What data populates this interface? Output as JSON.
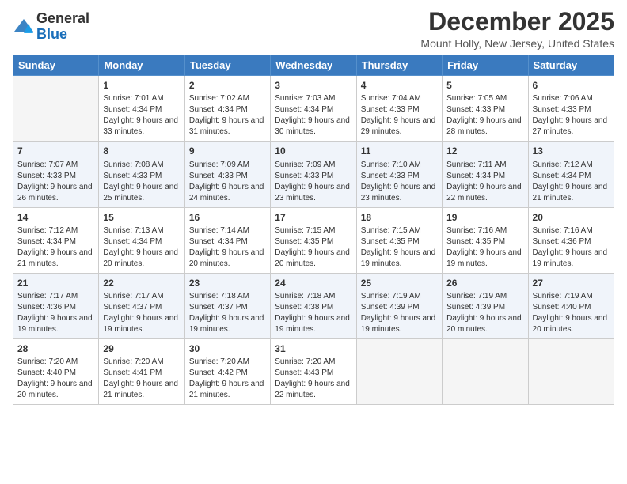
{
  "logo": {
    "text_general": "General",
    "text_blue": "Blue"
  },
  "header": {
    "month": "December 2025",
    "location": "Mount Holly, New Jersey, United States"
  },
  "days_of_week": [
    "Sunday",
    "Monday",
    "Tuesday",
    "Wednesday",
    "Thursday",
    "Friday",
    "Saturday"
  ],
  "weeks": [
    [
      {
        "day": "",
        "sunrise": "",
        "sunset": "",
        "daylight": "",
        "empty": true
      },
      {
        "day": "1",
        "sunrise": "Sunrise: 7:01 AM",
        "sunset": "Sunset: 4:34 PM",
        "daylight": "Daylight: 9 hours and 33 minutes."
      },
      {
        "day": "2",
        "sunrise": "Sunrise: 7:02 AM",
        "sunset": "Sunset: 4:34 PM",
        "daylight": "Daylight: 9 hours and 31 minutes."
      },
      {
        "day": "3",
        "sunrise": "Sunrise: 7:03 AM",
        "sunset": "Sunset: 4:34 PM",
        "daylight": "Daylight: 9 hours and 30 minutes."
      },
      {
        "day": "4",
        "sunrise": "Sunrise: 7:04 AM",
        "sunset": "Sunset: 4:33 PM",
        "daylight": "Daylight: 9 hours and 29 minutes."
      },
      {
        "day": "5",
        "sunrise": "Sunrise: 7:05 AM",
        "sunset": "Sunset: 4:33 PM",
        "daylight": "Daylight: 9 hours and 28 minutes."
      },
      {
        "day": "6",
        "sunrise": "Sunrise: 7:06 AM",
        "sunset": "Sunset: 4:33 PM",
        "daylight": "Daylight: 9 hours and 27 minutes."
      }
    ],
    [
      {
        "day": "7",
        "sunrise": "Sunrise: 7:07 AM",
        "sunset": "Sunset: 4:33 PM",
        "daylight": "Daylight: 9 hours and 26 minutes."
      },
      {
        "day": "8",
        "sunrise": "Sunrise: 7:08 AM",
        "sunset": "Sunset: 4:33 PM",
        "daylight": "Daylight: 9 hours and 25 minutes."
      },
      {
        "day": "9",
        "sunrise": "Sunrise: 7:09 AM",
        "sunset": "Sunset: 4:33 PM",
        "daylight": "Daylight: 9 hours and 24 minutes."
      },
      {
        "day": "10",
        "sunrise": "Sunrise: 7:09 AM",
        "sunset": "Sunset: 4:33 PM",
        "daylight": "Daylight: 9 hours and 23 minutes."
      },
      {
        "day": "11",
        "sunrise": "Sunrise: 7:10 AM",
        "sunset": "Sunset: 4:33 PM",
        "daylight": "Daylight: 9 hours and 23 minutes."
      },
      {
        "day": "12",
        "sunrise": "Sunrise: 7:11 AM",
        "sunset": "Sunset: 4:34 PM",
        "daylight": "Daylight: 9 hours and 22 minutes."
      },
      {
        "day": "13",
        "sunrise": "Sunrise: 7:12 AM",
        "sunset": "Sunset: 4:34 PM",
        "daylight": "Daylight: 9 hours and 21 minutes."
      }
    ],
    [
      {
        "day": "14",
        "sunrise": "Sunrise: 7:12 AM",
        "sunset": "Sunset: 4:34 PM",
        "daylight": "Daylight: 9 hours and 21 minutes."
      },
      {
        "day": "15",
        "sunrise": "Sunrise: 7:13 AM",
        "sunset": "Sunset: 4:34 PM",
        "daylight": "Daylight: 9 hours and 20 minutes."
      },
      {
        "day": "16",
        "sunrise": "Sunrise: 7:14 AM",
        "sunset": "Sunset: 4:34 PM",
        "daylight": "Daylight: 9 hours and 20 minutes."
      },
      {
        "day": "17",
        "sunrise": "Sunrise: 7:15 AM",
        "sunset": "Sunset: 4:35 PM",
        "daylight": "Daylight: 9 hours and 20 minutes."
      },
      {
        "day": "18",
        "sunrise": "Sunrise: 7:15 AM",
        "sunset": "Sunset: 4:35 PM",
        "daylight": "Daylight: 9 hours and 19 minutes."
      },
      {
        "day": "19",
        "sunrise": "Sunrise: 7:16 AM",
        "sunset": "Sunset: 4:35 PM",
        "daylight": "Daylight: 9 hours and 19 minutes."
      },
      {
        "day": "20",
        "sunrise": "Sunrise: 7:16 AM",
        "sunset": "Sunset: 4:36 PM",
        "daylight": "Daylight: 9 hours and 19 minutes."
      }
    ],
    [
      {
        "day": "21",
        "sunrise": "Sunrise: 7:17 AM",
        "sunset": "Sunset: 4:36 PM",
        "daylight": "Daylight: 9 hours and 19 minutes."
      },
      {
        "day": "22",
        "sunrise": "Sunrise: 7:17 AM",
        "sunset": "Sunset: 4:37 PM",
        "daylight": "Daylight: 9 hours and 19 minutes."
      },
      {
        "day": "23",
        "sunrise": "Sunrise: 7:18 AM",
        "sunset": "Sunset: 4:37 PM",
        "daylight": "Daylight: 9 hours and 19 minutes."
      },
      {
        "day": "24",
        "sunrise": "Sunrise: 7:18 AM",
        "sunset": "Sunset: 4:38 PM",
        "daylight": "Daylight: 9 hours and 19 minutes."
      },
      {
        "day": "25",
        "sunrise": "Sunrise: 7:19 AM",
        "sunset": "Sunset: 4:39 PM",
        "daylight": "Daylight: 9 hours and 19 minutes."
      },
      {
        "day": "26",
        "sunrise": "Sunrise: 7:19 AM",
        "sunset": "Sunset: 4:39 PM",
        "daylight": "Daylight: 9 hours and 20 minutes."
      },
      {
        "day": "27",
        "sunrise": "Sunrise: 7:19 AM",
        "sunset": "Sunset: 4:40 PM",
        "daylight": "Daylight: 9 hours and 20 minutes."
      }
    ],
    [
      {
        "day": "28",
        "sunrise": "Sunrise: 7:20 AM",
        "sunset": "Sunset: 4:40 PM",
        "daylight": "Daylight: 9 hours and 20 minutes."
      },
      {
        "day": "29",
        "sunrise": "Sunrise: 7:20 AM",
        "sunset": "Sunset: 4:41 PM",
        "daylight": "Daylight: 9 hours and 21 minutes."
      },
      {
        "day": "30",
        "sunrise": "Sunrise: 7:20 AM",
        "sunset": "Sunset: 4:42 PM",
        "daylight": "Daylight: 9 hours and 21 minutes."
      },
      {
        "day": "31",
        "sunrise": "Sunrise: 7:20 AM",
        "sunset": "Sunset: 4:43 PM",
        "daylight": "Daylight: 9 hours and 22 minutes."
      },
      {
        "day": "",
        "sunrise": "",
        "sunset": "",
        "daylight": "",
        "empty": true
      },
      {
        "day": "",
        "sunrise": "",
        "sunset": "",
        "daylight": "",
        "empty": true
      },
      {
        "day": "",
        "sunrise": "",
        "sunset": "",
        "daylight": "",
        "empty": true
      }
    ]
  ]
}
